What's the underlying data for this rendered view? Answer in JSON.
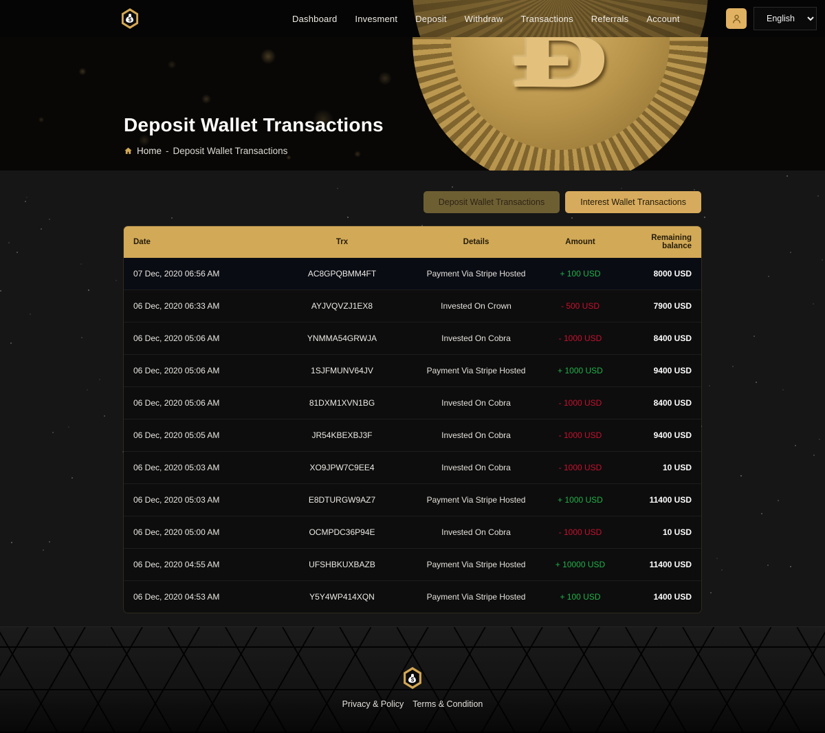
{
  "header": {
    "logo_icon": "money-bag-hex-logo",
    "nav": [
      {
        "label": "Dashboard"
      },
      {
        "label": "Invesment"
      },
      {
        "label": "Deposit"
      },
      {
        "label": "Withdraw"
      },
      {
        "label": "Transactions"
      },
      {
        "label": "Referrals"
      },
      {
        "label": "Account"
      }
    ],
    "user_icon": "user-icon",
    "language": {
      "selected": "English",
      "options": [
        "English"
      ]
    }
  },
  "hero": {
    "title": "Deposit Wallet Transactions",
    "breadcrumb": {
      "home_icon": "home-icon",
      "home": "Home",
      "separator": "-",
      "current": "Deposit Wallet Transactions"
    },
    "coin_symbol": "Ƀ"
  },
  "tabs": [
    {
      "label": "Deposit Wallet Transactions",
      "state": "muted"
    },
    {
      "label": "Interest Wallet Transactions",
      "state": "active"
    }
  ],
  "table": {
    "columns": [
      "Date",
      "Trx",
      "Details",
      "Amount",
      "Remaining balance"
    ],
    "rows": [
      {
        "date": "07 Dec, 2020 06:56 AM",
        "trx": "AC8GPQBMM4FT",
        "details": "Payment Via Stripe Hosted",
        "amount": "+ 100 USD",
        "sign": "plus",
        "balance": "8000 USD"
      },
      {
        "date": "06 Dec, 2020 06:33 AM",
        "trx": "AYJVQVZJ1EX8",
        "details": "Invested On Crown",
        "amount": "- 500 USD",
        "sign": "minus",
        "balance": "7900 USD"
      },
      {
        "date": "06 Dec, 2020 05:06 AM",
        "trx": "YNMMA54GRWJA",
        "details": "Invested On Cobra",
        "amount": "- 1000 USD",
        "sign": "minus",
        "balance": "8400 USD"
      },
      {
        "date": "06 Dec, 2020 05:06 AM",
        "trx": "1SJFMUNV64JV",
        "details": "Payment Via Stripe Hosted",
        "amount": "+ 1000 USD",
        "sign": "plus",
        "balance": "9400 USD"
      },
      {
        "date": "06 Dec, 2020 05:06 AM",
        "trx": "81DXM1XVN1BG",
        "details": "Invested On Cobra",
        "amount": "- 1000 USD",
        "sign": "minus",
        "balance": "8400 USD"
      },
      {
        "date": "06 Dec, 2020 05:05 AM",
        "trx": "JR54KBEXBJ3F",
        "details": "Invested On Cobra",
        "amount": "- 1000 USD",
        "sign": "minus",
        "balance": "9400 USD"
      },
      {
        "date": "06 Dec, 2020 05:03 AM",
        "trx": "XO9JPW7C9EE4",
        "details": "Invested On Cobra",
        "amount": "- 1000 USD",
        "sign": "minus",
        "balance": "10 USD"
      },
      {
        "date": "06 Dec, 2020 05:03 AM",
        "trx": "E8DTURGW9AZ7",
        "details": "Payment Via Stripe Hosted",
        "amount": "+ 1000 USD",
        "sign": "plus",
        "balance": "11400 USD"
      },
      {
        "date": "06 Dec, 2020 05:00 AM",
        "trx": "OCMPDC36P94E",
        "details": "Invested On Cobra",
        "amount": "- 1000 USD",
        "sign": "minus",
        "balance": "10 USD"
      },
      {
        "date": "06 Dec, 2020 04:55 AM",
        "trx": "UFSHBKUXBAZB",
        "details": "Payment Via Stripe Hosted",
        "amount": "+ 10000 USD",
        "sign": "plus",
        "balance": "11400 USD"
      },
      {
        "date": "06 Dec, 2020 04:53 AM",
        "trx": "Y5Y4WP414XQN",
        "details": "Payment Via Stripe Hosted",
        "amount": "+ 100 USD",
        "sign": "plus",
        "balance": "1400 USD"
      }
    ]
  },
  "footer": {
    "logo_icon": "money-bag-hex-logo",
    "links": [
      {
        "label": "Privacy & Policy"
      },
      {
        "label": "Terms & Condition"
      }
    ]
  },
  "colors": {
    "gold": "#d2a957",
    "gold_muted": "#6e5f33",
    "positive": "#1fb34a",
    "negative": "#c8102e",
    "page_bg": "#161616"
  }
}
